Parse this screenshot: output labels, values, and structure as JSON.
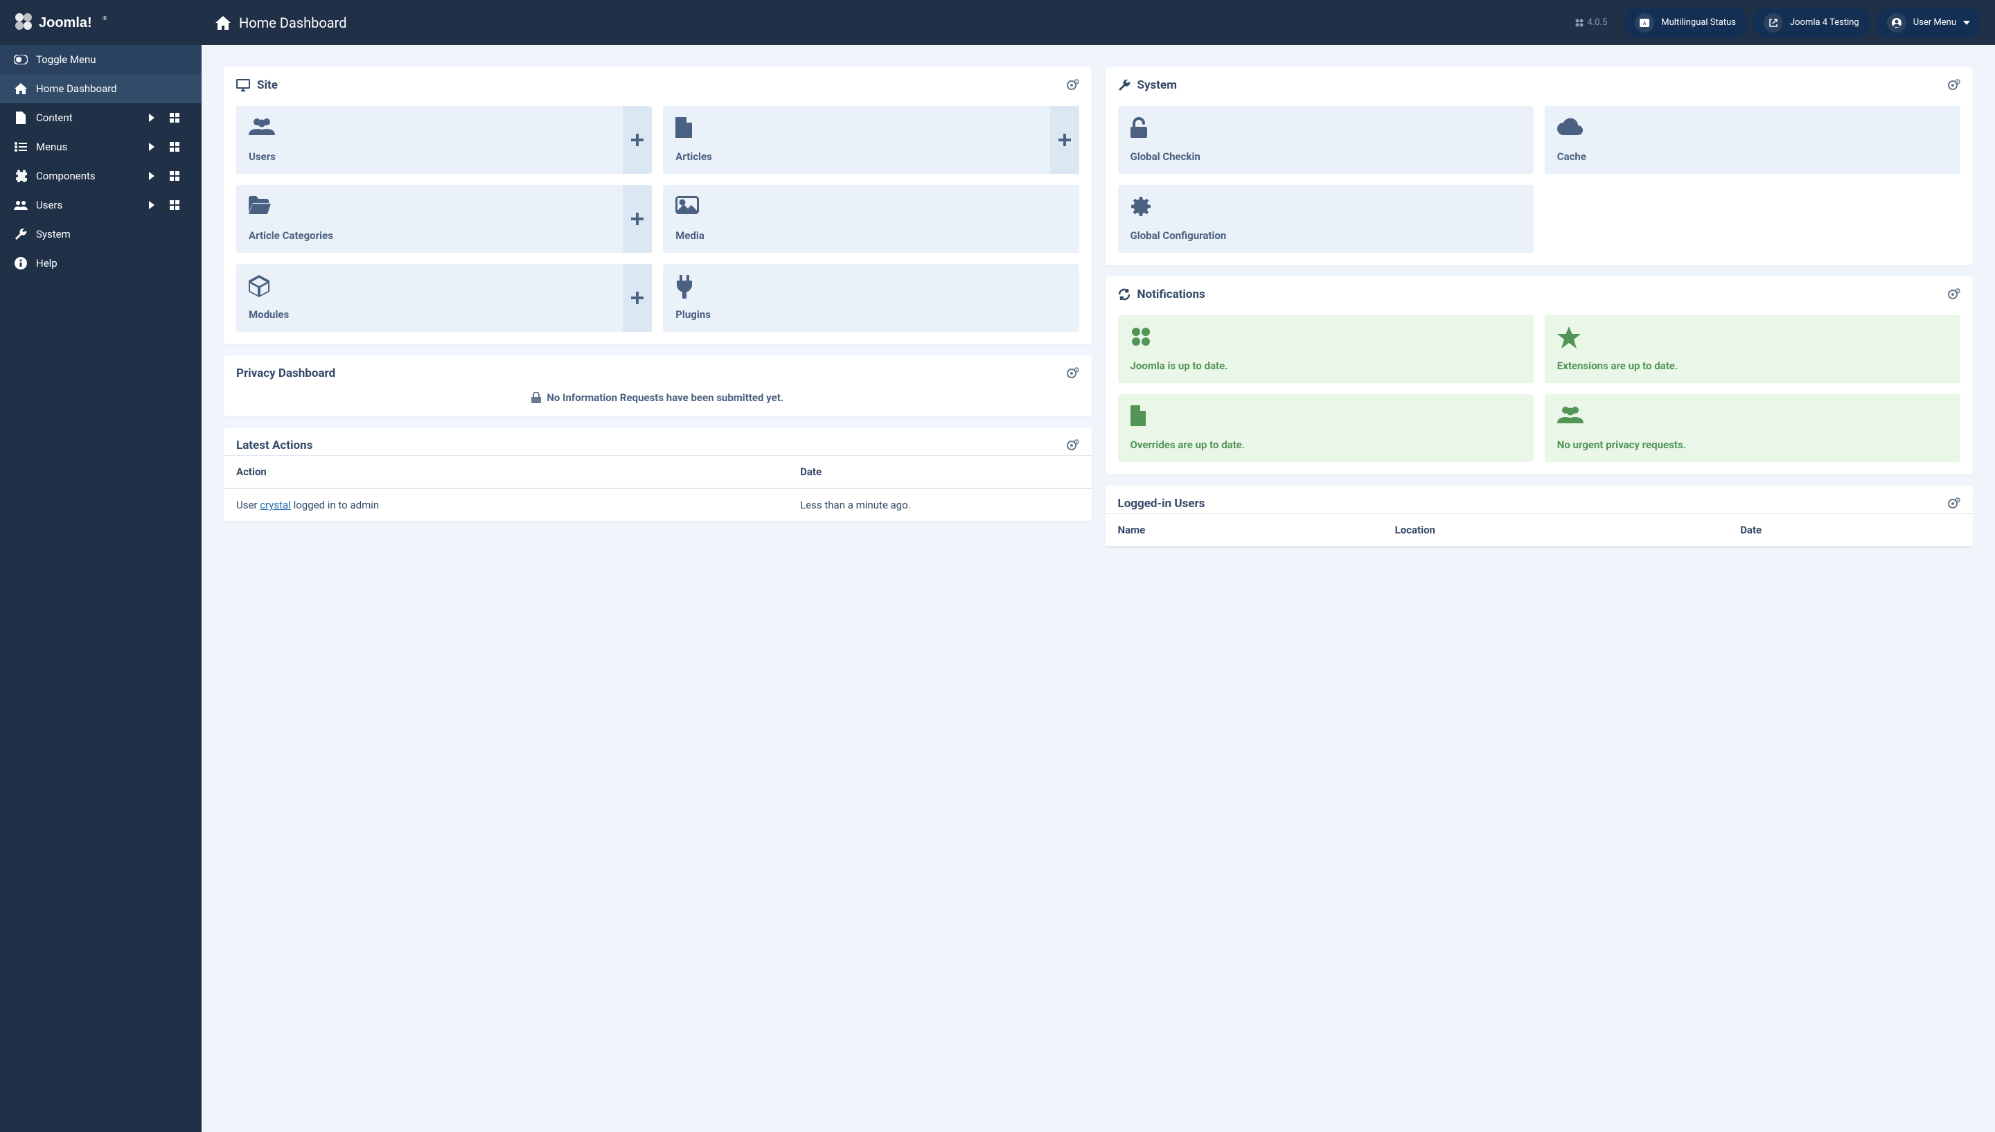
{
  "brand": "Joomla!",
  "version": "4.0.5",
  "header": {
    "title": "Home Dashboard",
    "multilingual": "Multilingual Status",
    "testing": "Joomla 4 Testing",
    "usermenu": "User Menu"
  },
  "sidebar": {
    "toggle": "Toggle Menu",
    "items": [
      {
        "label": "Home Dashboard"
      },
      {
        "label": "Content"
      },
      {
        "label": "Menus"
      },
      {
        "label": "Components"
      },
      {
        "label": "Users"
      },
      {
        "label": "System"
      },
      {
        "label": "Help"
      }
    ]
  },
  "panels": {
    "site": {
      "title": "Site",
      "tiles": [
        {
          "label": "Users",
          "plus": true
        },
        {
          "label": "Articles",
          "plus": true
        },
        {
          "label": "Article Categories",
          "plus": true
        },
        {
          "label": "Media",
          "plus": false
        },
        {
          "label": "Modules",
          "plus": true
        },
        {
          "label": "Plugins",
          "plus": false
        }
      ]
    },
    "privacy": {
      "title": "Privacy Dashboard",
      "empty": "No Information Requests have been submitted yet."
    },
    "latest": {
      "title": "Latest Actions",
      "cols": [
        "Action",
        "Date"
      ],
      "rows": [
        {
          "user_prefix": "User ",
          "user_link": "crystal",
          "user_suffix": " logged in to admin",
          "date": "Less than a minute ago."
        }
      ]
    },
    "system": {
      "title": "System",
      "tiles": [
        {
          "label": "Global Checkin"
        },
        {
          "label": "Cache"
        },
        {
          "label": "Global Configuration"
        }
      ]
    },
    "notifications": {
      "title": "Notifications",
      "tiles": [
        {
          "label": "Joomla is up to date."
        },
        {
          "label": "Extensions are up to date."
        },
        {
          "label": "Overrides are up to date."
        },
        {
          "label": "No urgent privacy requests."
        }
      ]
    },
    "loggedin": {
      "title": "Logged-in Users",
      "cols": [
        "Name",
        "Location",
        "Date"
      ]
    }
  }
}
